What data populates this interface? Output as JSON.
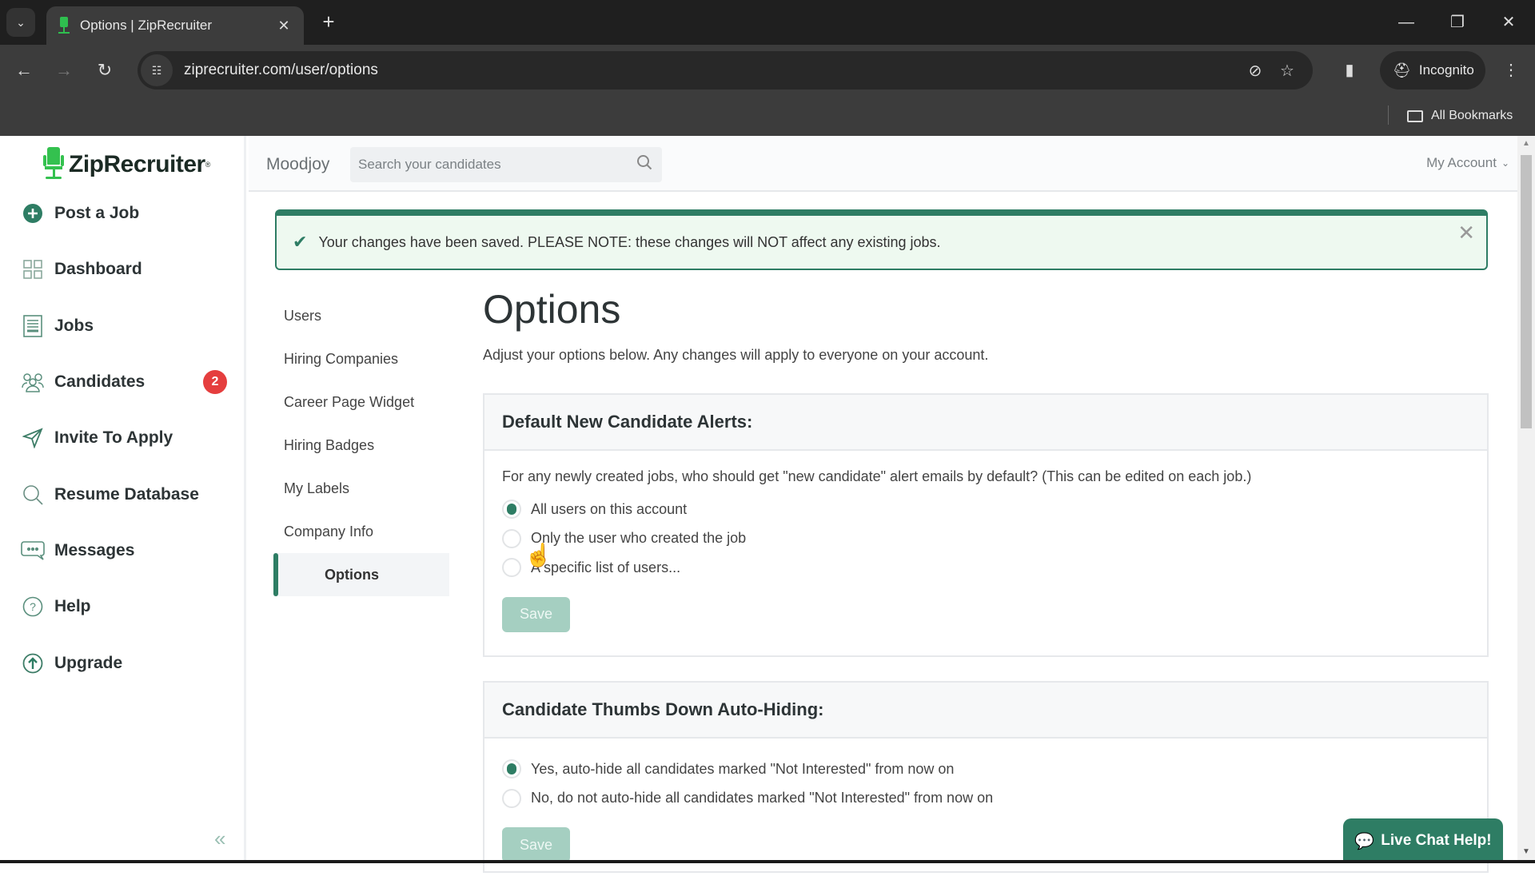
{
  "browser": {
    "tab_title": "Options | ZipRecruiter",
    "url": "ziprecruiter.com/user/options",
    "profile_label": "Incognito",
    "bookmarks_label": "All Bookmarks",
    "icons": {
      "tab_search": "chevron-down-icon",
      "close_tab": "close-icon",
      "new_tab": "plus-icon",
      "back": "arrow-left-icon",
      "forward": "arrow-right-icon",
      "reload": "reload-icon",
      "site_info": "tune-icon",
      "eye_off": "eye-off-icon",
      "bookmark": "star-icon",
      "side_panel": "side-panel-icon",
      "menu": "more-vert-icon"
    },
    "glyphs": {
      "chevron": "⌄",
      "close": "✕",
      "plus": "+",
      "minimize": "—",
      "restore": "❐",
      "back": "←",
      "forward": "→",
      "reload": "↻",
      "tune": "☷",
      "eye_off": "⊘",
      "star": "☆",
      "panel": "▮",
      "incognito": "⛑",
      "menu": "⋮"
    }
  },
  "app": {
    "brand": "ZipRecruiter",
    "brand_mark": "®",
    "company": "Moodjoy",
    "search": {
      "placeholder": "Search your candidates",
      "value": ""
    },
    "account_label": "My Account",
    "colors": {
      "accent": "#2e7d64",
      "brand_green": "#34c14f",
      "badge_red": "#e53e3e",
      "alert_bg": "#eef9f0"
    }
  },
  "sidebar": {
    "items": [
      {
        "label": "Post a Job",
        "icon": "plus-circle-icon"
      },
      {
        "label": "Dashboard",
        "icon": "grid-icon"
      },
      {
        "label": "Jobs",
        "icon": "document-icon"
      },
      {
        "label": "Candidates",
        "icon": "people-icon",
        "badge": "2"
      },
      {
        "label": "Invite To Apply",
        "icon": "send-icon"
      },
      {
        "label": "Resume Database",
        "icon": "search-icon"
      },
      {
        "label": "Messages",
        "icon": "chat-icon"
      },
      {
        "label": "Help",
        "icon": "help-circle-icon"
      },
      {
        "label": "Upgrade",
        "icon": "upgrade-icon"
      }
    ],
    "collapse_glyph": "«"
  },
  "alert": {
    "message": "Your changes have been saved. PLEASE NOTE: these changes will NOT affect any existing jobs.",
    "check_glyph": "✔",
    "close_glyph": "✕"
  },
  "sub_nav": {
    "items": [
      {
        "label": "Users",
        "active": false
      },
      {
        "label": "Hiring Companies",
        "active": false
      },
      {
        "label": "Career Page Widget",
        "active": false
      },
      {
        "label": "Hiring Badges",
        "active": false
      },
      {
        "label": "My Labels",
        "active": false
      },
      {
        "label": "Company Info",
        "active": false
      },
      {
        "label": "Options",
        "active": true
      }
    ]
  },
  "main": {
    "title": "Options",
    "description": "Adjust your options below. Any changes will apply to everyone on your account.",
    "sections": [
      {
        "title": "Default New Candidate Alerts:",
        "question": "For any newly created jobs, who should get \"new candidate\" alert emails by default? (This can be edited on each job.)",
        "options": [
          {
            "label": "All users on this account",
            "checked": true
          },
          {
            "label": "Only the user who created the job",
            "checked": false
          },
          {
            "label": "A specific list of users...",
            "checked": false
          }
        ],
        "save_label": "Save"
      },
      {
        "title": "Candidate Thumbs Down Auto-Hiding:",
        "options": [
          {
            "label": "Yes, auto-hide all candidates marked \"Not Interested\" from now on",
            "checked": true
          },
          {
            "label": "No, do not auto-hide all candidates marked \"Not Interested\" from now on",
            "checked": false
          }
        ],
        "save_label": "Save"
      }
    ]
  },
  "live_chat": {
    "label": "Live Chat Help!",
    "glyph": "💬"
  }
}
